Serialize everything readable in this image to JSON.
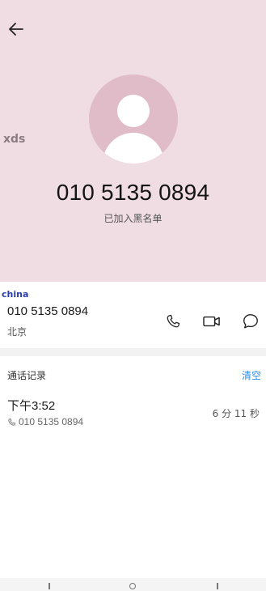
{
  "header": {
    "back_icon": "arrow-left-icon",
    "avatar_icon": "person-icon",
    "phone_number": "010 5135 0894",
    "status": "已加入黑名单",
    "watermark": "xds"
  },
  "contact": {
    "watermark": "china",
    "number": "010 5135 0894",
    "location": "北京",
    "actions": [
      "phone-icon",
      "video-icon",
      "message-icon"
    ]
  },
  "records": {
    "title": "通话记录",
    "clear_label": "清空",
    "items": [
      {
        "time": "下午3:52",
        "number": "010 5135 0894",
        "duration": "6 分 11 秒"
      }
    ]
  },
  "colors": {
    "header_bg": "#efdde3",
    "avatar_bg": "#dfbcc7",
    "accent": "#2a8ee8"
  }
}
